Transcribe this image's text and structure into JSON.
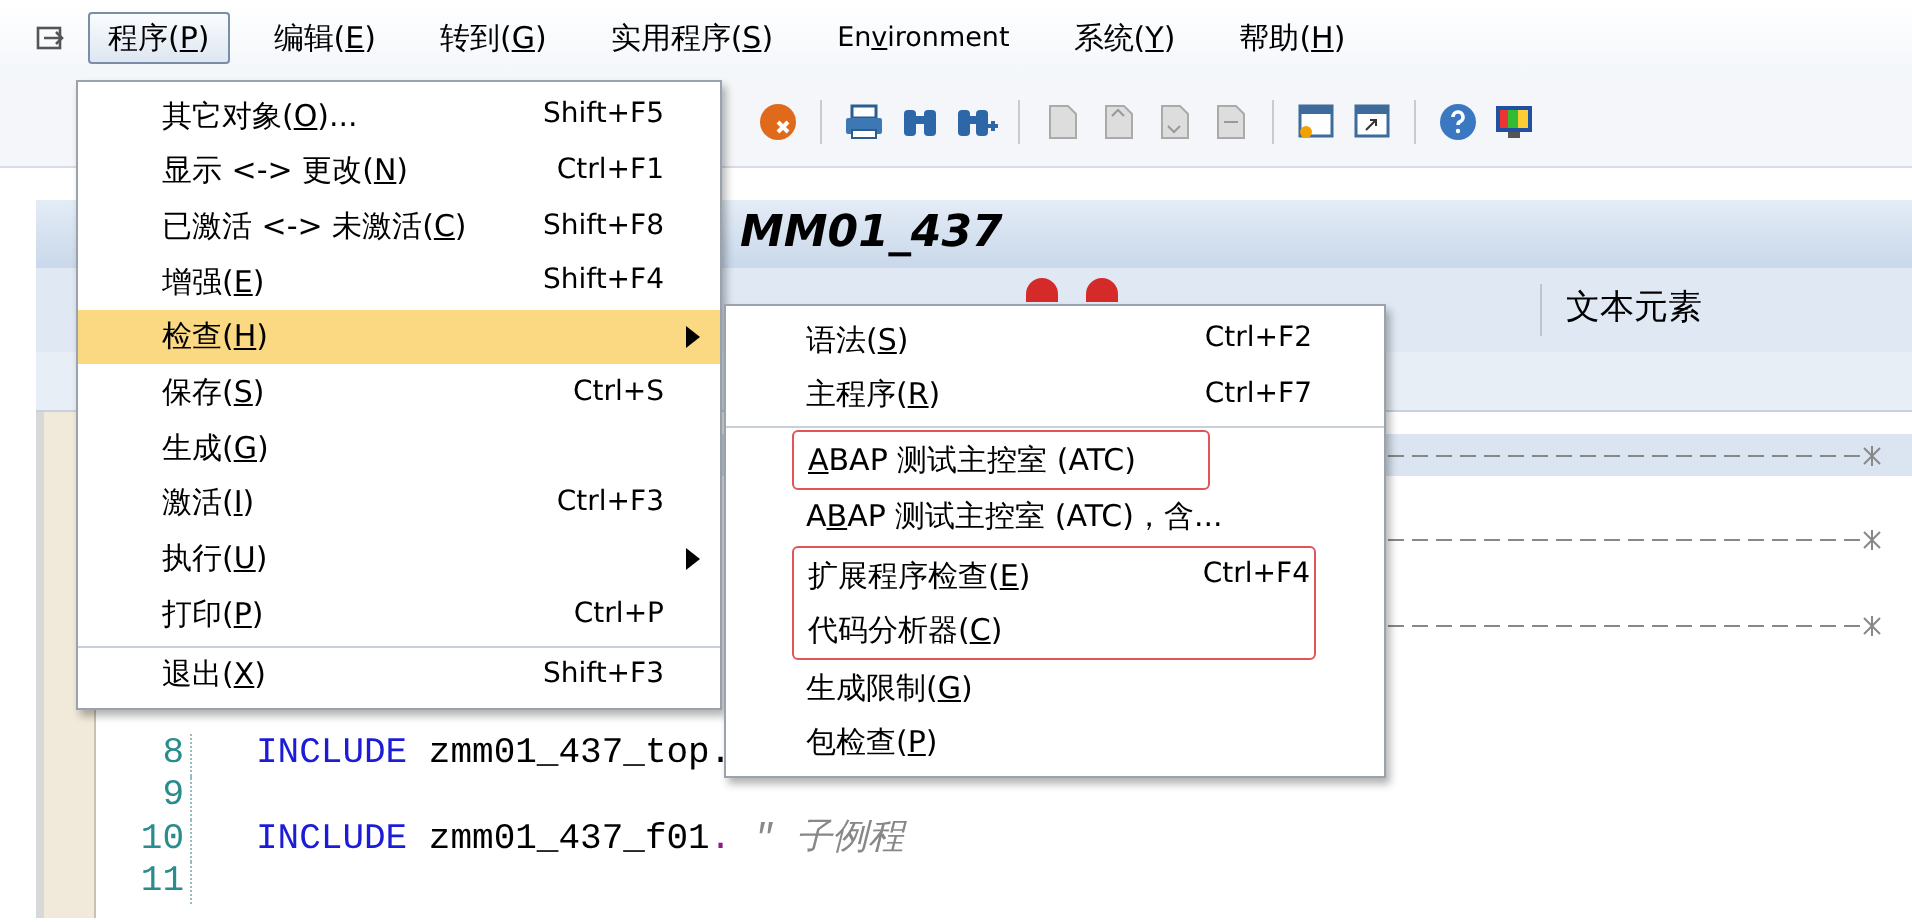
{
  "menubar": {
    "items": [
      {
        "label": {
          "pre": "程序(",
          "key": "P",
          "post": ")"
        },
        "selected": true
      },
      {
        "label": {
          "pre": "编辑(",
          "key": "E",
          "post": ")"
        },
        "selected": false
      },
      {
        "label": {
          "pre": "转到(",
          "key": "G",
          "post": ")"
        },
        "selected": false
      },
      {
        "label": {
          "pre": "实用程序(",
          "key": "S",
          "post": ")"
        },
        "selected": false
      },
      {
        "label": {
          "pre": "En",
          "key": "v",
          "post": "ironment"
        },
        "selected": false
      },
      {
        "label": {
          "pre": "系统(",
          "key": "Y",
          "post": ")"
        },
        "selected": false
      },
      {
        "label": {
          "pre": "帮助(",
          "key": "H",
          "post": ")"
        },
        "selected": false
      }
    ]
  },
  "window_title": "MM01_437",
  "app_toolbar": {
    "items": [
      "文本元素"
    ]
  },
  "editor": {
    "lines": [
      {
        "kind": "rule",
        "current": true
      },
      {
        "kind": "blank"
      },
      {
        "kind": "rule",
        "current": false
      },
      {
        "kind": "blank"
      },
      {
        "kind": "rule",
        "current": false
      },
      {
        "kind": "blank"
      },
      {
        "kind": "blank"
      },
      {
        "kind": "code",
        "number": "8",
        "tokens": [
          {
            "kind": "keyword",
            "text": "INCLUDE"
          },
          {
            "kind": "plain",
            "text": " zmm01_437_top."
          }
        ]
      },
      {
        "kind": "code",
        "number": "9"
      },
      {
        "kind": "code",
        "number": "10",
        "tokens": [
          {
            "kind": "keyword",
            "text": "INCLUDE"
          },
          {
            "kind": "plain",
            "text": " zmm01_437_f01"
          },
          {
            "kind": "punct",
            "text": "."
          },
          {
            "kind": "comment",
            "text": " ″ 子例程"
          }
        ]
      },
      {
        "kind": "code",
        "number": "11"
      }
    ]
  },
  "program_menu": {
    "items": [
      {
        "label": {
          "pre": "其它对象(",
          "key": "O",
          "post": ")..."
        },
        "shortcut": "Shift+F5",
        "selected": false,
        "submenu": false,
        "divider_before": false
      },
      {
        "label": {
          "pre": "显示 <-> 更改(",
          "key": "N",
          "post": ")"
        },
        "shortcut": "Ctrl+F1",
        "selected": false,
        "submenu": false,
        "divider_before": false
      },
      {
        "label": {
          "pre": "已激活 <-> 未激活(",
          "key": "C",
          "post": ")"
        },
        "shortcut": "Shift+F8",
        "selected": false,
        "submenu": false,
        "divider_before": false
      },
      {
        "label": {
          "pre": "增强(",
          "key": "E",
          "post": ")"
        },
        "shortcut": "Shift+F4",
        "selected": false,
        "submenu": false,
        "divider_before": false
      },
      {
        "label": {
          "pre": "检查(",
          "key": "H",
          "post": ")"
        },
        "selected": true,
        "submenu": true,
        "divider_before": false
      },
      {
        "label": {
          "pre": "保存(",
          "key": "S",
          "post": ")"
        },
        "shortcut": "Ctrl+S",
        "selected": false,
        "submenu": false,
        "divider_before": false
      },
      {
        "label": {
          "pre": "生成(",
          "key": "G",
          "post": ")"
        },
        "selected": false,
        "submenu": false,
        "divider_before": false
      },
      {
        "label": {
          "pre": "激活(",
          "key": "I",
          "post": ")"
        },
        "shortcut": "Ctrl+F3",
        "selected": false,
        "submenu": false,
        "divider_before": false
      },
      {
        "label": {
          "pre": "执行(",
          "key": "U",
          "post": ")"
        },
        "selected": false,
        "submenu": true,
        "divider_before": false
      },
      {
        "label": {
          "pre": "打印(",
          "key": "P",
          "post": ")"
        },
        "shortcut": "Ctrl+P",
        "selected": false,
        "submenu": false,
        "divider_before": false
      },
      {
        "label": {
          "pre": "退出(",
          "key": "X",
          "post": ")"
        },
        "shortcut": "Shift+F3",
        "selected": false,
        "submenu": false,
        "divider_before": true
      }
    ]
  },
  "check_submenu": {
    "items": [
      {
        "label": {
          "pre": "语法(",
          "key": "S",
          "post": ")"
        },
        "shortcut": "Ctrl+F2",
        "outlined": false,
        "divider_before": false
      },
      {
        "label": {
          "pre": "主程序(",
          "key": "R",
          "post": ")"
        },
        "shortcut": "Ctrl+F7",
        "outlined": false,
        "divider_before": false
      },
      {
        "label": {
          "key": "A",
          "post": "BAP 测试主控室 (ATC)"
        },
        "outlined": true,
        "divider_before": true
      },
      {
        "label": {
          "pre": "A",
          "key": "B",
          "post": "AP 测试主控室 (ATC)，含..."
        },
        "outlined": false,
        "divider_before": false
      },
      {
        "label": {
          "pre": "扩展程序检查(",
          "key": "E",
          "post": ")"
        },
        "shortcut": "Ctrl+F4",
        "outlined": true,
        "divider_before": false
      },
      {
        "label": {
          "pre": "代码分析器(",
          "key": "C",
          "post": ")"
        },
        "outlined": true,
        "divider_before": false
      },
      {
        "label": {
          "pre": "生成限制(",
          "key": "G",
          "post": ")"
        },
        "outlined": false,
        "divider_before": false
      },
      {
        "label": {
          "pre": "包检查(",
          "key": "P",
          "post": ")"
        },
        "outlined": false,
        "divider_before": false
      }
    ]
  }
}
